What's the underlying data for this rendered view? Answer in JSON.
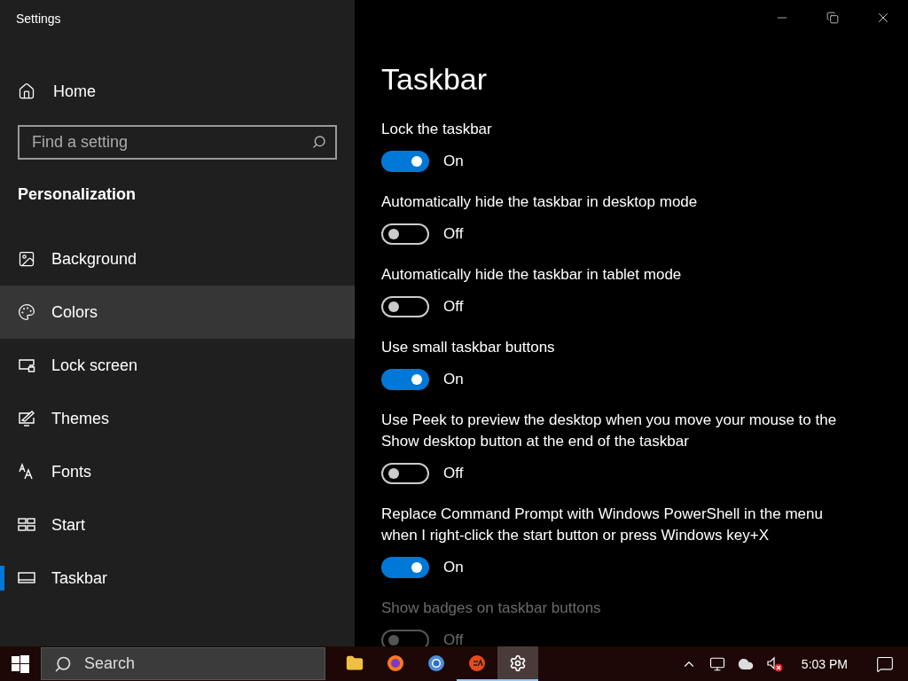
{
  "window": {
    "title": "Settings"
  },
  "sidebar": {
    "home": "Home",
    "search": {
      "placeholder": "Find a setting"
    },
    "section": "Personalization",
    "items": [
      {
        "label": "Background",
        "kind": "background",
        "selected": false,
        "hovered": false
      },
      {
        "label": "Colors",
        "kind": "colors",
        "selected": false,
        "hovered": true
      },
      {
        "label": "Lock screen",
        "kind": "lockscreen",
        "selected": false,
        "hovered": false
      },
      {
        "label": "Themes",
        "kind": "themes",
        "selected": false,
        "hovered": false
      },
      {
        "label": "Fonts",
        "kind": "fonts",
        "selected": false,
        "hovered": false
      },
      {
        "label": "Start",
        "kind": "start",
        "selected": false,
        "hovered": false
      },
      {
        "label": "Taskbar",
        "kind": "taskbar",
        "selected": true,
        "hovered": false
      }
    ]
  },
  "page": {
    "title": "Taskbar",
    "settings": [
      {
        "label": "Lock the taskbar",
        "on": true,
        "disabled": false,
        "state_text": "On"
      },
      {
        "label": "Automatically hide the taskbar in desktop mode",
        "on": false,
        "disabled": false,
        "state_text": "Off"
      },
      {
        "label": "Automatically hide the taskbar in tablet mode",
        "on": false,
        "disabled": false,
        "state_text": "Off"
      },
      {
        "label": "Use small taskbar buttons",
        "on": true,
        "disabled": false,
        "state_text": "On"
      },
      {
        "label": "Use Peek to preview the desktop when you move your mouse to the Show desktop button at the end of the taskbar",
        "on": false,
        "disabled": false,
        "state_text": "Off"
      },
      {
        "label": "Replace Command Prompt with Windows PowerShell in the menu when I right-click the start button or press Windows key+X",
        "on": true,
        "disabled": false,
        "state_text": "On"
      },
      {
        "label": "Show badges on taskbar buttons",
        "on": false,
        "disabled": true,
        "state_text": "Off"
      }
    ]
  },
  "taskbar": {
    "search": "Search",
    "apps": [
      {
        "kind": "folder",
        "running": false,
        "active": false
      },
      {
        "kind": "firefox",
        "running": false,
        "active": false
      },
      {
        "kind": "browser",
        "running": false,
        "active": false
      },
      {
        "kind": "ea",
        "running": true,
        "active": false
      },
      {
        "kind": "settings",
        "running": true,
        "active": true
      }
    ],
    "time": "5:03 PM"
  }
}
